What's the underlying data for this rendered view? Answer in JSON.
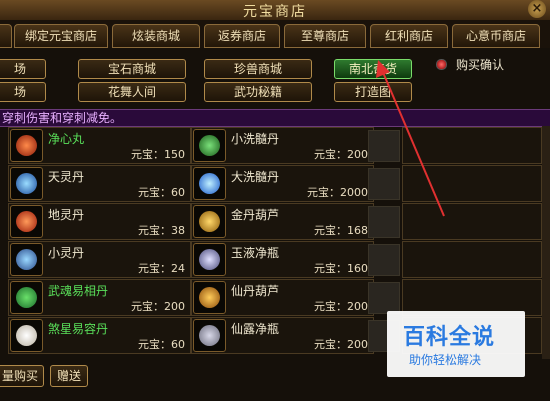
{
  "window": {
    "title": "元宝商店",
    "close_glyph": "×"
  },
  "tabs": [
    "绑定元宝商店",
    "炫装商城",
    "返券商店",
    "至尊商店",
    "红利商店",
    "心意币商店"
  ],
  "tab_left_fragment": "",
  "categories": {
    "row1": [
      "场",
      "宝石商城",
      "珍兽商城",
      "南北奇货"
    ],
    "row2": [
      "场",
      "花舞人间",
      "武功秘籍",
      "打造图"
    ],
    "active": "南北奇货"
  },
  "purchase_confirm": {
    "label": "购买确认"
  },
  "notice": "穿刺伤害和穿刺减免。",
  "currency_label": "元宝：",
  "items": [
    {
      "left": {
        "name": "净心丸",
        "price": "150",
        "name_color": "#5ae05a",
        "icon": "red-crystal-icon"
      },
      "right": {
        "name": "小洗髓丹",
        "price": "200",
        "name_color": "#f0e8d0",
        "icon": "green-chest-icon"
      }
    },
    {
      "left": {
        "name": "天灵丹",
        "price": "60",
        "name_color": "#f0e8d0",
        "icon": "blue-pill-icon"
      },
      "right": {
        "name": "大洗髓丹",
        "price": "2000",
        "name_color": "#f0e8d0",
        "icon": "blue-orb-icon"
      }
    },
    {
      "left": {
        "name": "地灵丹",
        "price": "38",
        "name_color": "#f0e8d0",
        "icon": "red-pill-icon"
      },
      "right": {
        "name": "金丹葫芦",
        "price": "168",
        "name_color": "#f0e8d0",
        "icon": "gold-gourd-icon"
      }
    },
    {
      "left": {
        "name": "小灵丹",
        "price": "24",
        "name_color": "#f0e8d0",
        "icon": "blue-small-pill-icon"
      },
      "right": {
        "name": "玉液净瓶",
        "price": "160",
        "name_color": "#f0e8d0",
        "icon": "jade-vase-icon"
      }
    },
    {
      "left": {
        "name": "武魂易相丹",
        "price": "200",
        "name_color": "#5ae05a",
        "icon": "green-flask-icon"
      },
      "right": {
        "name": "仙丹葫芦",
        "price": "200",
        "name_color": "#f0e8d0",
        "icon": "gourd-icon"
      }
    },
    {
      "left": {
        "name": "煞星易容丹",
        "price": "60",
        "name_color": "#5ae05a",
        "icon": "pearl-icon"
      },
      "right": {
        "name": "仙露净瓶",
        "price": "200",
        "name_color": "#f0e8d0",
        "icon": "silver-vase-icon"
      }
    }
  ],
  "bottom": {
    "bulk_buy": "量购买",
    "gift": "赠送"
  },
  "watermark": {
    "big": "百科全说",
    "small": "助你轻松解决"
  },
  "colors": {
    "accent_green": "#5ae05a",
    "annotation_arrow": "#e03030"
  }
}
